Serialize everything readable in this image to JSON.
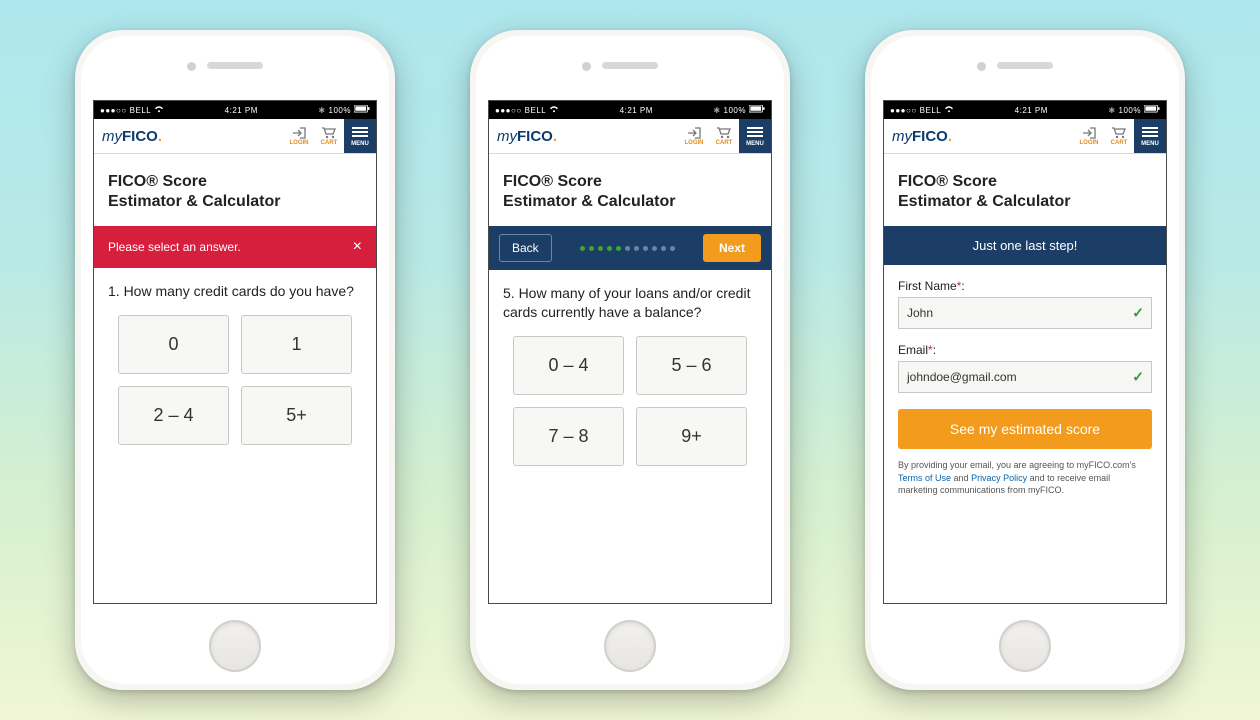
{
  "statusbar": {
    "carrier": "BELL",
    "signal": "●●●○○",
    "time": "4:21 PM",
    "battery": "100%"
  },
  "appbar": {
    "logo_my": "my",
    "logo_fico": "FICO",
    "login": "LOGIN",
    "cart": "CART",
    "menu": "MENU"
  },
  "page_title_line1": "FICO® Score",
  "page_title_line2": "Estimator & Calculator",
  "screen1": {
    "error": "Please select an answer.",
    "question": "1. How many credit cards do you have?",
    "options": [
      "0",
      "1",
      "2 – 4",
      "5+"
    ]
  },
  "screen2": {
    "back": "Back",
    "next": "Next",
    "progress_done": 5,
    "progress_total": 11,
    "question": "5. How many of your loans and/or credit cards currently have a balance?",
    "options": [
      "0 – 4",
      "5 – 6",
      "7 – 8",
      "9+"
    ]
  },
  "screen3": {
    "header": "Just one last step!",
    "first_name_label": "First Name",
    "first_name_value": "John",
    "email_label": "Email",
    "email_value": "johndoe@gmail.com",
    "submit": "See my estimated score",
    "legal_pre": "By providing your email, you are agreeing to myFICO.com's ",
    "terms": "Terms of Use",
    "and": " and ",
    "privacy": "Privacy Policy",
    "legal_post": " and to receive email marketing communications from myFICO."
  }
}
